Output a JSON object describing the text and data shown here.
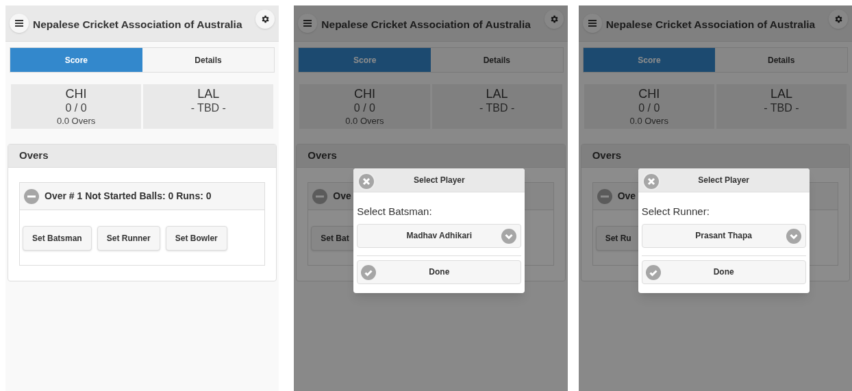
{
  "screens": [
    {
      "header": {
        "title": "Nepalese Cricket Association of Australia"
      },
      "tabs": [
        {
          "label": "Score",
          "selected": true
        },
        {
          "label": "Details",
          "selected": false
        }
      ],
      "teams": [
        {
          "name": "CHI",
          "score": "0 / 0",
          "overs": "0.0 Overs"
        },
        {
          "name": "LAL",
          "score": "- TBD -"
        }
      ],
      "overs_panel": {
        "title": "Overs",
        "over": {
          "expanded": true,
          "summary": "Over # 1 Not Started Balls: 0 Runs: 0",
          "buttons": [
            "Set Batsman",
            "Set Runner",
            "Set Bowler"
          ]
        }
      }
    },
    {
      "header": {
        "title": "Nepalese Cricket Association of Australia"
      },
      "tabs": [
        {
          "label": "Score",
          "selected": true
        },
        {
          "label": "Details",
          "selected": false
        }
      ],
      "teams": [
        {
          "name": "CHI",
          "score": "0 / 0",
          "overs": "0.0 Overs"
        },
        {
          "name": "LAL",
          "score": "- TBD -"
        }
      ],
      "overs_panel": {
        "title": "Overs",
        "over": {
          "expanded": true,
          "summary": "Ove",
          "buttons": [
            "Set Bat"
          ]
        }
      },
      "dialog": {
        "title": "Select Player",
        "label": "Select Batsman:",
        "value": "Madhav Adhikari",
        "button": "Done"
      }
    },
    {
      "header": {
        "title": "Nepalese Cricket Association of Australia"
      },
      "tabs": [
        {
          "label": "Score",
          "selected": true
        },
        {
          "label": "Details",
          "selected": false
        }
      ],
      "teams": [
        {
          "name": "CHI",
          "score": "0 / 0",
          "overs": "0.0 Overs"
        },
        {
          "name": "LAL",
          "score": "- TBD -"
        }
      ],
      "overs_panel": {
        "title": "Overs",
        "over": {
          "expanded": true,
          "summary": "Ove",
          "buttons": [
            "Set Ru"
          ]
        }
      },
      "dialog": {
        "title": "Select Player",
        "label": "Select Runner:",
        "value": "Prasant Thapa",
        "button": "Done"
      }
    }
  ]
}
